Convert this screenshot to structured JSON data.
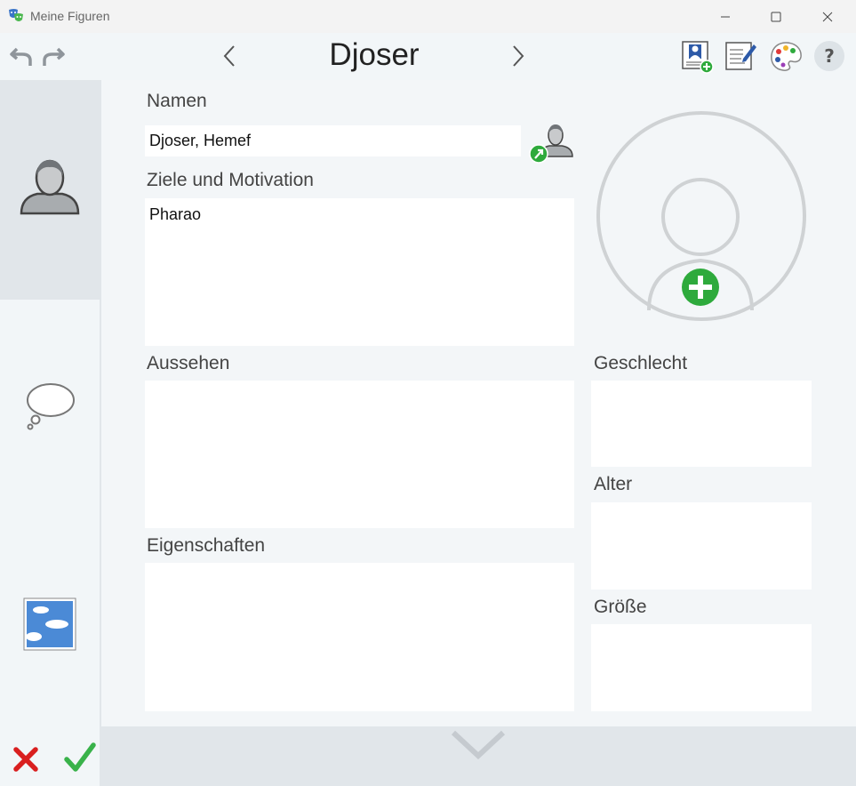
{
  "window": {
    "title": "Meine Figuren",
    "minimize_glyph": "—",
    "maximize_glyph": "☐",
    "close_glyph": "✕"
  },
  "toolbar": {
    "prev_glyph": "<",
    "next_glyph": ">",
    "character_name": "Djoser",
    "help_label": "?"
  },
  "form": {
    "name_label": "Namen",
    "name_value": "Djoser, Hemef",
    "goals_label": "Ziele und Motivation",
    "goals_value": "Pharao",
    "appearance_label": "Aussehen",
    "appearance_value": "",
    "traits_label": "Eigenschaften",
    "traits_value": "",
    "gender_label": "Geschlecht",
    "gender_value": "",
    "age_label": "Alter",
    "age_value": "",
    "height_label": "Größe",
    "height_value": ""
  },
  "icons": {
    "app": "theater-masks-icon",
    "undo": "undo-icon",
    "redo": "redo-icon",
    "add_character": "add-character-icon",
    "edit_notes": "edit-notes-icon",
    "palette": "palette-icon",
    "person_tab": "person-icon",
    "thought_tab": "thought-bubble-icon",
    "scene_tab": "sky-picture-icon",
    "cancel": "cancel-icon",
    "confirm": "confirm-icon"
  },
  "colors": {
    "accent_green": "#2eaa3c",
    "cancel_red": "#d91f1f",
    "tab_active": "#e1e6ea"
  }
}
